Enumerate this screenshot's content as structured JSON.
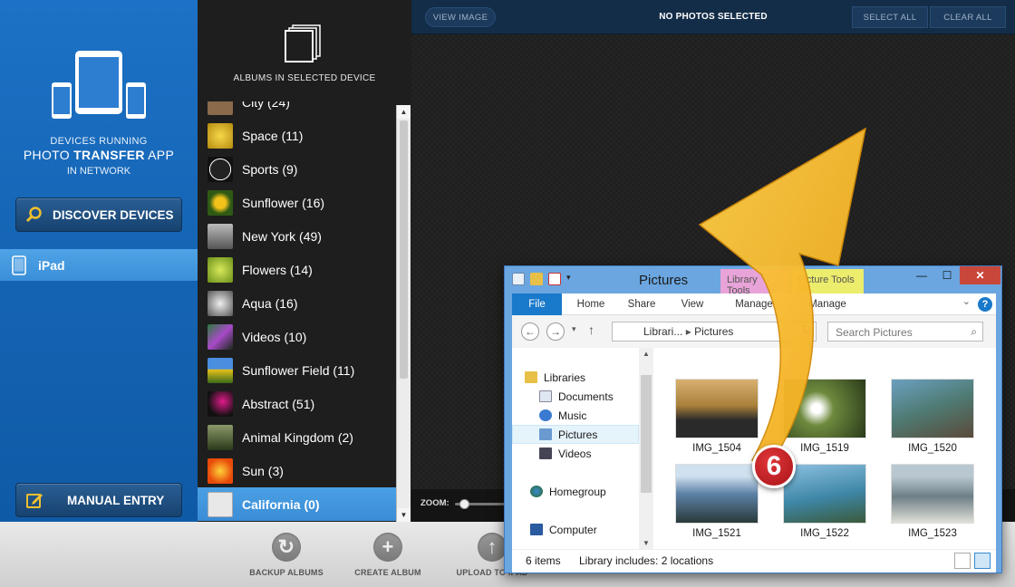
{
  "sidebar": {
    "line1": "DEVICES RUNNING",
    "line2a": "PHOTO ",
    "line2b": "TRANSFER",
    "line2c": " APP",
    "line3": "IN NETWORK",
    "discover_label": "DISCOVER DEVICES",
    "manual_label": "MANUAL ENTRY",
    "devices": [
      {
        "label": "iPad"
      }
    ]
  },
  "albums": {
    "header": "ALBUMS IN SELECTED DEVICE",
    "items": [
      {
        "label": "City (24)",
        "color": "#8a6a4a"
      },
      {
        "label": "Space (11)",
        "color": "#c9a21a"
      },
      {
        "label": "Sports (9)",
        "color": "#111111"
      },
      {
        "label": "Sunflower (16)",
        "color": "#3c6b1c"
      },
      {
        "label": "New York (49)",
        "color": "#7d7d7d"
      },
      {
        "label": "Flowers (14)",
        "color": "#9abf2a"
      },
      {
        "label": "Aqua (16)",
        "color": "#9a9a9a"
      },
      {
        "label": "Videos (10)",
        "color": "#6a3a8a"
      },
      {
        "label": "Sunflower Field (11)",
        "color": "#3f7fd0"
      },
      {
        "label": "Abstract (51)",
        "color": "#b0157a"
      },
      {
        "label": "Animal Kingdom (2)",
        "color": "#5a6a3a"
      },
      {
        "label": "Sun (3)",
        "color": "#e85a10"
      },
      {
        "label": "California (0)",
        "color": "#dcdcdc"
      }
    ],
    "selected": "California (0)"
  },
  "topbar": {
    "view_image": "VIEW IMAGE",
    "status": "NO PHOTOS SELECTED",
    "select_all": "SELECT ALL",
    "clear_all": "CLEAR ALL"
  },
  "zoom": {
    "label": "ZOOM:",
    "level": 0.17
  },
  "toolbar": {
    "backup": "BACKUP ALBUMS",
    "create": "CREATE ALBUM",
    "upload": "UPLOAD TO IPAD"
  },
  "explorer": {
    "title": "Pictures",
    "context_library": "Library Tools",
    "context_picture": "Picture Tools",
    "tabs": [
      "File",
      "Home",
      "Share",
      "View",
      "Manage",
      "Manage"
    ],
    "path_1": "Librari...",
    "path_2": "Pictures",
    "search_placeholder": "Search Pictures",
    "nav": [
      "Libraries",
      "Documents",
      "Music",
      "Pictures",
      "Videos",
      "Homegroup",
      "Computer"
    ],
    "files": [
      {
        "name": "IMG_1504",
        "color": "#a9803a"
      },
      {
        "name": "IMG_1519",
        "color": "#6e8a3d"
      },
      {
        "name": "IMG_1520",
        "color": "#4f7a72"
      },
      {
        "name": "IMG_1521",
        "color": "#5d82a7"
      },
      {
        "name": "IMG_1522",
        "color": "#3e86a6"
      },
      {
        "name": "IMG_1523",
        "color": "#6d7f86"
      }
    ],
    "status_items": "6 items",
    "status_lib": "Library includes: 2 locations"
  },
  "step_badge": "6"
}
